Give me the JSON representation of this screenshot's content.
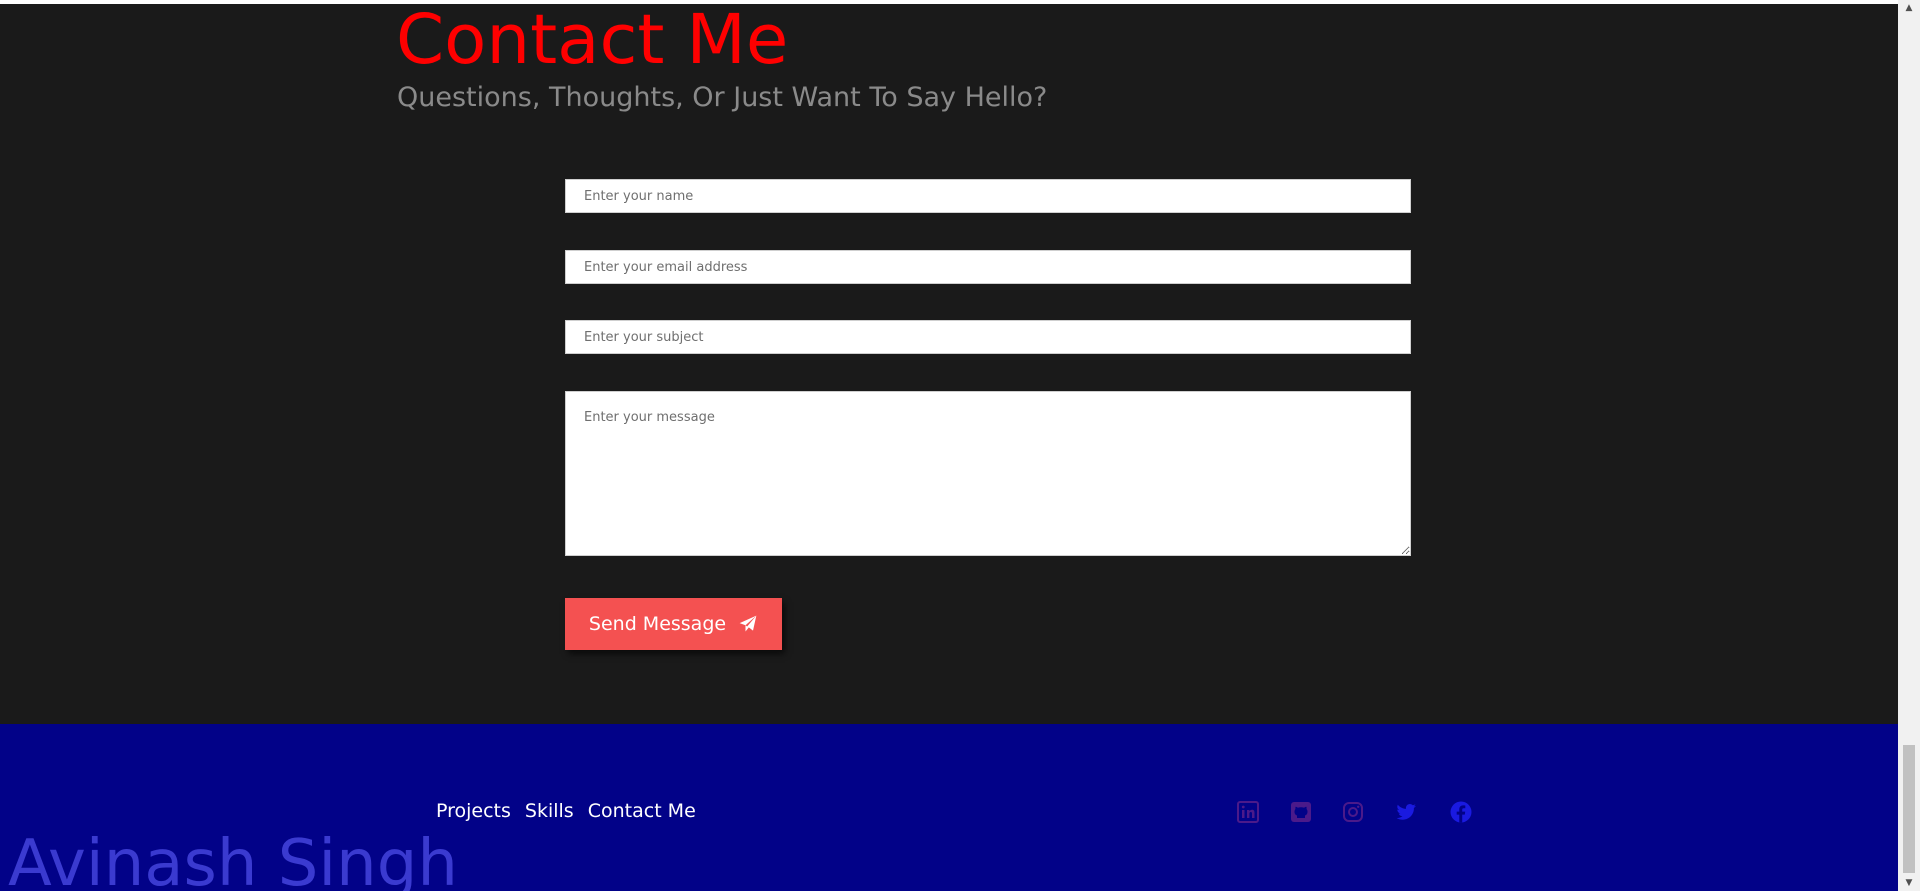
{
  "contact": {
    "title": "Contact Me",
    "subtitle": "Questions, Thoughts, Or Just Want To Say Hello?",
    "name_placeholder": "Enter your name",
    "email_placeholder": "Enter your email address",
    "subject_placeholder": "Enter your subject",
    "message_placeholder": "Enter your message",
    "send_label": "Send Message",
    "send_icon": "paper-plane-icon"
  },
  "footer": {
    "nav": [
      "Projects",
      "Skills",
      "Contact Me"
    ],
    "brand": "Avinash Singh",
    "social_icons": [
      "linkedin-icon",
      "github-icon",
      "instagram-icon",
      "twitter-icon",
      "facebook-icon"
    ]
  },
  "colors": {
    "title": "#ff0000",
    "subtitle": "#8a8a8a",
    "section_bg": "#1a1a1a",
    "button": "#f45151",
    "footer_bg": "#020288",
    "footer_brand": "#3a3ad0",
    "social_purple": "#4b1a8a",
    "social_blue": "#1a1ae0"
  }
}
